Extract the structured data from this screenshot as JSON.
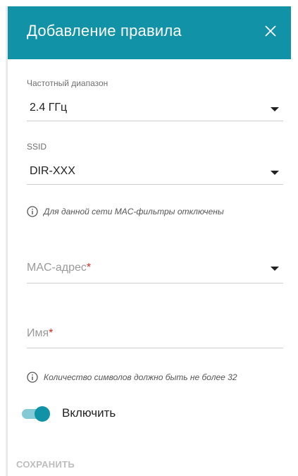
{
  "dialog": {
    "title": "Добавление правила",
    "close_icon": "close-icon"
  },
  "fields": {
    "band": {
      "label": "Частотный диапазон",
      "value": "2.4 ГГц"
    },
    "ssid": {
      "label": "SSID",
      "value": "DIR-XXX"
    },
    "mac_info": "Для данной сети MAC-фильтры отключены",
    "mac": {
      "placeholder": "MAC-адрес",
      "required_mark": "*"
    },
    "name": {
      "placeholder": "Имя",
      "required_mark": "*"
    },
    "name_info": "Количество символов должно быть не более 32"
  },
  "enable": {
    "label": "Включить",
    "on": true
  },
  "save_label": "СОХРАНИТЬ",
  "colors": {
    "accent": "#1192a6",
    "required": "#e0281e",
    "disabled_text": "#bdbdbd"
  }
}
